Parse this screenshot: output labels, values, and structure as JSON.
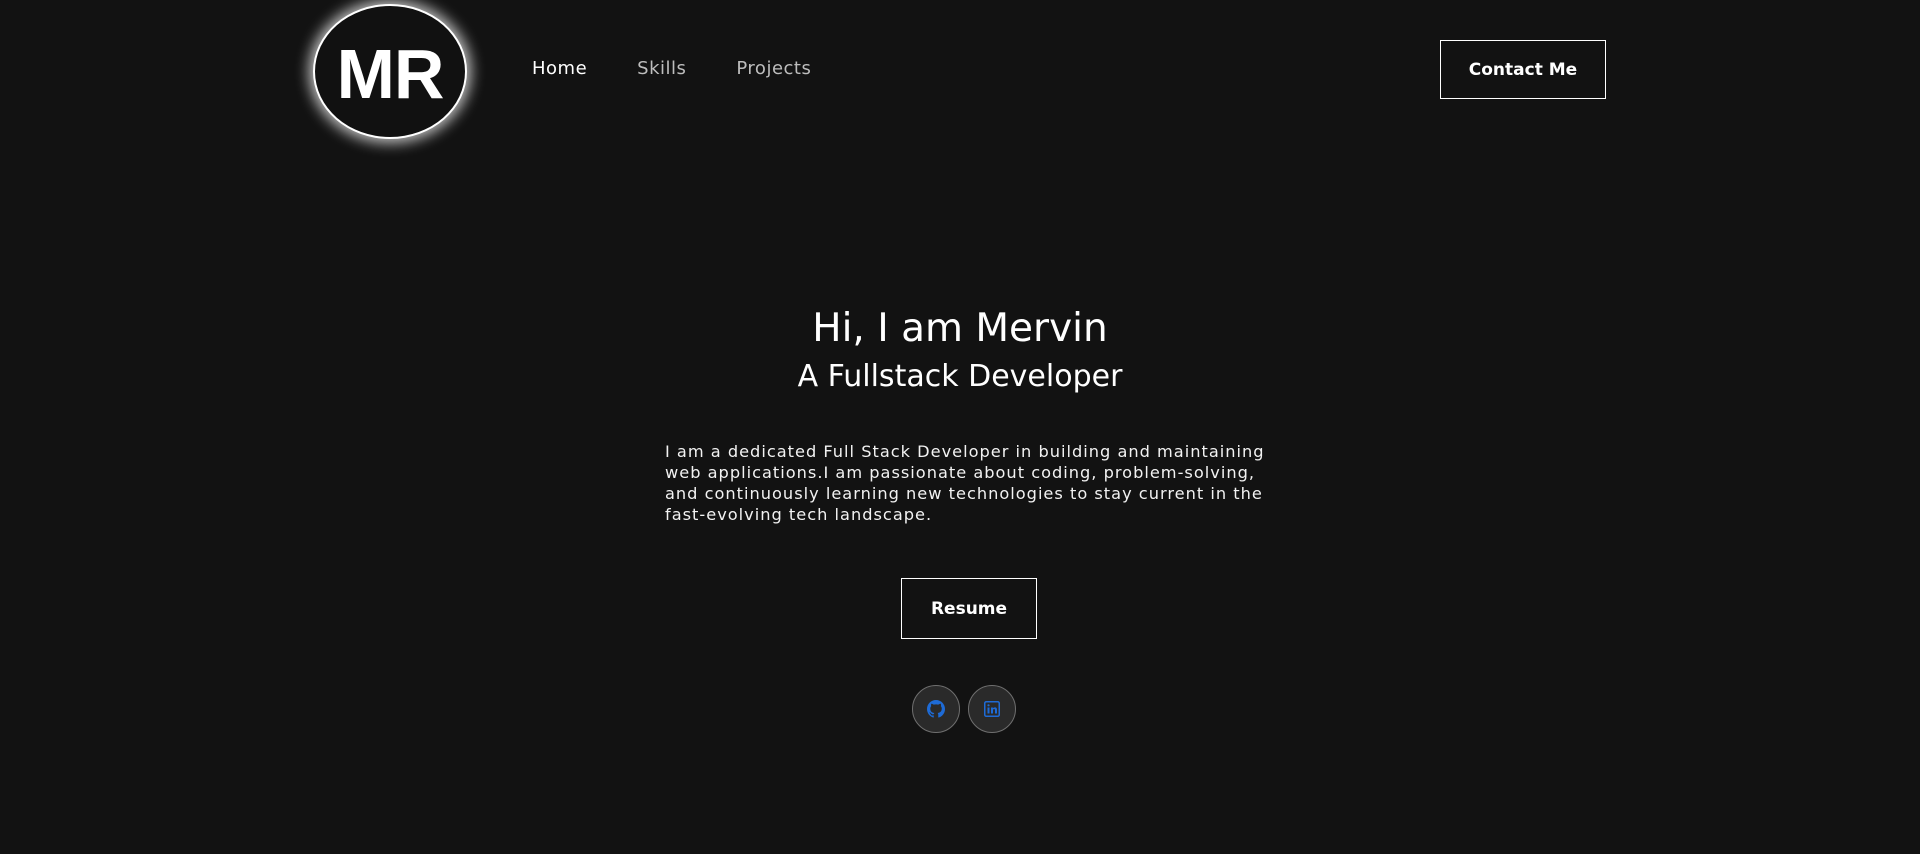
{
  "header": {
    "logo_text": "MR",
    "nav": [
      {
        "label": "Home",
        "active": true
      },
      {
        "label": "Skills",
        "active": false
      },
      {
        "label": "Projects",
        "active": false
      }
    ],
    "contact_label": "Contact Me"
  },
  "hero": {
    "title": "Hi, I am Mervin",
    "subtitle": "A Fullstack Developer",
    "description": "I am a dedicated Full Stack Developer in building and maintaining web applications.I am passionate about coding, problem-solving, and continuously learning new technologies to stay current in the fast-evolving tech landscape.",
    "resume_label": "Resume"
  },
  "social": [
    {
      "icon": "github-icon",
      "color": "#1e6bd6"
    },
    {
      "icon": "linkedin-icon",
      "color": "#1e6bd6"
    }
  ],
  "colors": {
    "background": "#121212",
    "text": "#ffffff",
    "nav_inactive": "#bdbdbd",
    "icon_accent": "#1e6bd6"
  }
}
